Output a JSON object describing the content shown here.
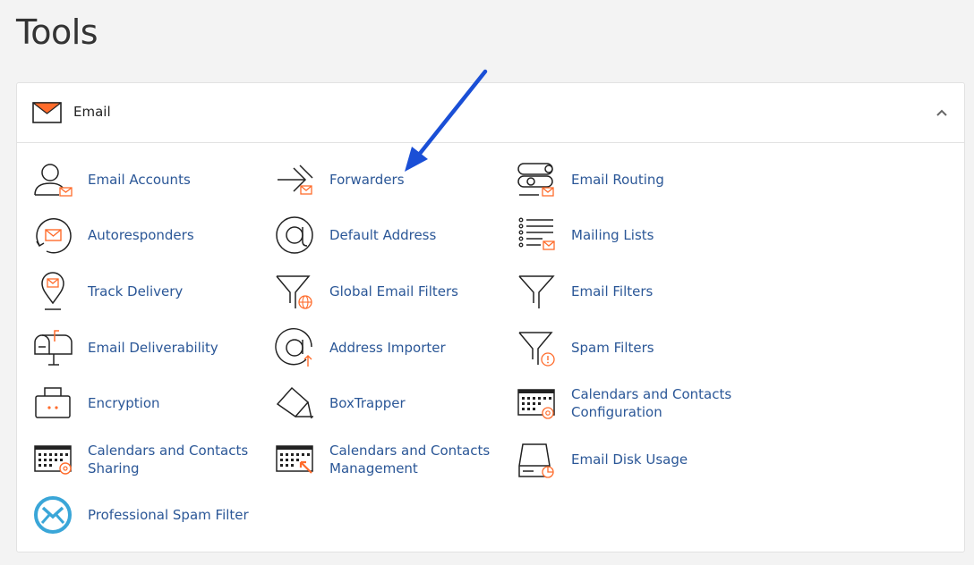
{
  "page": {
    "title": "Tools"
  },
  "section": {
    "title": "Email",
    "collapse_icon": "chevron-up-icon"
  },
  "tools": [
    {
      "label": "Email Accounts",
      "icon": "email-accounts-icon"
    },
    {
      "label": "Forwarders",
      "icon": "forwarders-icon"
    },
    {
      "label": "Email Routing",
      "icon": "email-routing-icon"
    },
    {
      "label": "Autoresponders",
      "icon": "autoresponders-icon"
    },
    {
      "label": "Default Address",
      "icon": "default-address-icon"
    },
    {
      "label": "Mailing Lists",
      "icon": "mailing-lists-icon"
    },
    {
      "label": "Track Delivery",
      "icon": "track-delivery-icon"
    },
    {
      "label": "Global Email Filters",
      "icon": "global-email-filters-icon"
    },
    {
      "label": "Email Filters",
      "icon": "email-filters-icon"
    },
    {
      "label": "Email Deliverability",
      "icon": "email-deliverability-icon"
    },
    {
      "label": "Address Importer",
      "icon": "address-importer-icon"
    },
    {
      "label": "Spam Filters",
      "icon": "spam-filters-icon"
    },
    {
      "label": "Encryption",
      "icon": "encryption-icon"
    },
    {
      "label": "BoxTrapper",
      "icon": "boxtrapper-icon"
    },
    {
      "label": "Calendars and Contacts Configuration",
      "icon": "calendars-contacts-configuration-icon"
    },
    {
      "label": "Calendars and Contacts Sharing",
      "icon": "calendars-contacts-sharing-icon"
    },
    {
      "label": "Calendars and Contacts Management",
      "icon": "calendars-contacts-management-icon"
    },
    {
      "label": "Email Disk Usage",
      "icon": "email-disk-usage-icon"
    },
    {
      "label": "Professional Spam Filter",
      "icon": "professional-spam-filter-icon"
    }
  ],
  "annotation": {
    "icon": "blue-arrow-icon",
    "color": "#1a4fd6",
    "points_to": "Forwarders"
  },
  "colors": {
    "accent": "#ff6c2c",
    "link": "#2b5797",
    "icon_stroke": "#222222",
    "spam_filter": "#3aa6d8"
  }
}
